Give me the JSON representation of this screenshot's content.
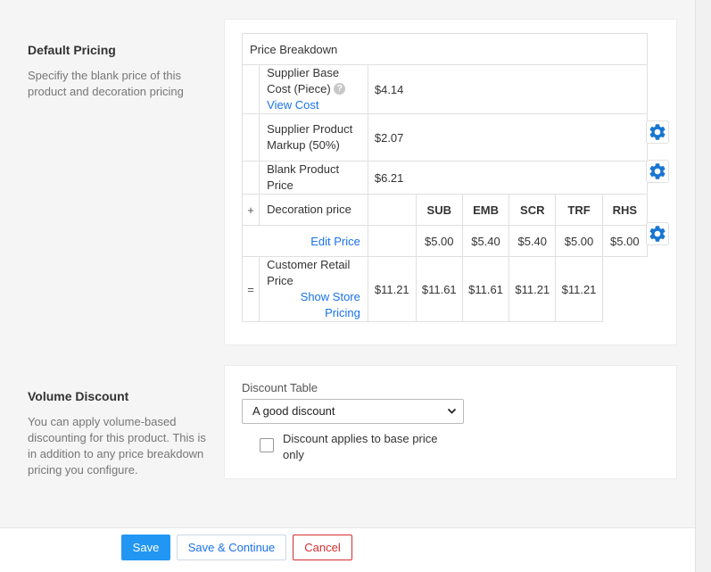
{
  "colors": {
    "accent": "#2196f3",
    "link": "#1a73e8",
    "danger": "#d32f2f",
    "gear": "#1976d2"
  },
  "default_pricing": {
    "title": "Default Pricing",
    "description": "Specifiy the blank price of this product and decoration pricing"
  },
  "price_breakdown": {
    "title": "Price Breakdown",
    "supplier_base_cost": {
      "label": "Supplier Base Cost (Piece)",
      "help_icon": "question-circle",
      "link": "View Cost",
      "value": "$4.14"
    },
    "supplier_markup": {
      "label": "Supplier Product Markup (50%)",
      "value": "$2.07"
    },
    "blank_product_price": {
      "label": "Blank Product Price",
      "value": "$6.21"
    },
    "decoration": {
      "prefix": "+",
      "label": "Decoration price",
      "columns": [
        "SUB",
        "EMB",
        "SCR",
        "TRF",
        "RHS"
      ],
      "edit_link": "Edit Price",
      "prices": [
        "$5.00",
        "$5.40",
        "$5.40",
        "$5.00",
        "$5.00"
      ]
    },
    "customer_retail": {
      "prefix": "=",
      "label": "Customer Retail Price",
      "link": "Show Store Pricing",
      "prices": [
        "$11.21",
        "$11.61",
        "$11.61",
        "$11.21",
        "$11.21"
      ]
    },
    "settings_icon": "gear-icon"
  },
  "volume_discount": {
    "title": "Volume Discount",
    "description": "You can apply volume-based discounting for this product. This is in addition to any price breakdown pricing you configure.",
    "table_label": "Discount Table",
    "selected": "A good discount",
    "checkbox_label": "Discount applies to base price only",
    "checkbox_checked": false
  },
  "footer": {
    "save": "Save",
    "save_continue": "Save & Continue",
    "cancel": "Cancel"
  }
}
